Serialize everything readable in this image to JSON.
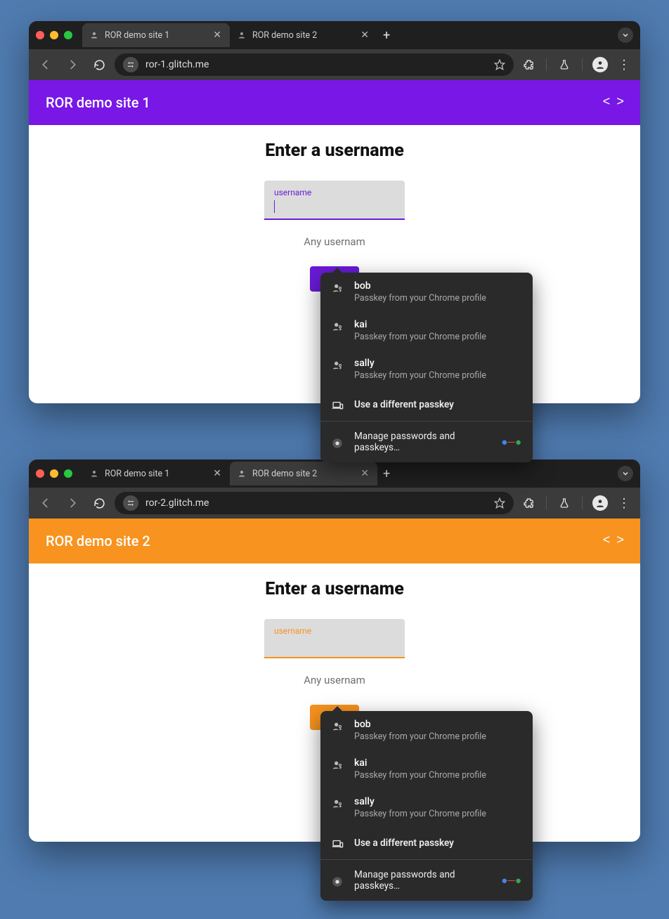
{
  "windows": [
    {
      "tabs": [
        {
          "title": "ROR demo site 1",
          "active": true
        },
        {
          "title": "ROR demo site 2",
          "active": false
        }
      ],
      "url": "ror-1.glitch.me",
      "header_title": "ROR demo site 1",
      "accent": "purple",
      "page_heading": "Enter a username",
      "field_label": "username",
      "helper_text": "Any usernam",
      "show_caret": true
    },
    {
      "tabs": [
        {
          "title": "ROR demo site 1",
          "active": false
        },
        {
          "title": "ROR demo site 2",
          "active": true
        }
      ],
      "url": "ror-2.glitch.me",
      "header_title": "ROR demo site 2",
      "accent": "orange",
      "page_heading": "Enter a username",
      "field_label": "username",
      "helper_text": "Any usernam",
      "show_caret": false
    }
  ],
  "passkey_popup": {
    "items": [
      {
        "name": "bob",
        "sub": "Passkey from your Chrome profile"
      },
      {
        "name": "kai",
        "sub": "Passkey from your Chrome profile"
      },
      {
        "name": "sally",
        "sub": "Passkey from your Chrome profile"
      }
    ],
    "different": "Use a different passkey",
    "manage": "Manage passwords and passkeys…"
  }
}
